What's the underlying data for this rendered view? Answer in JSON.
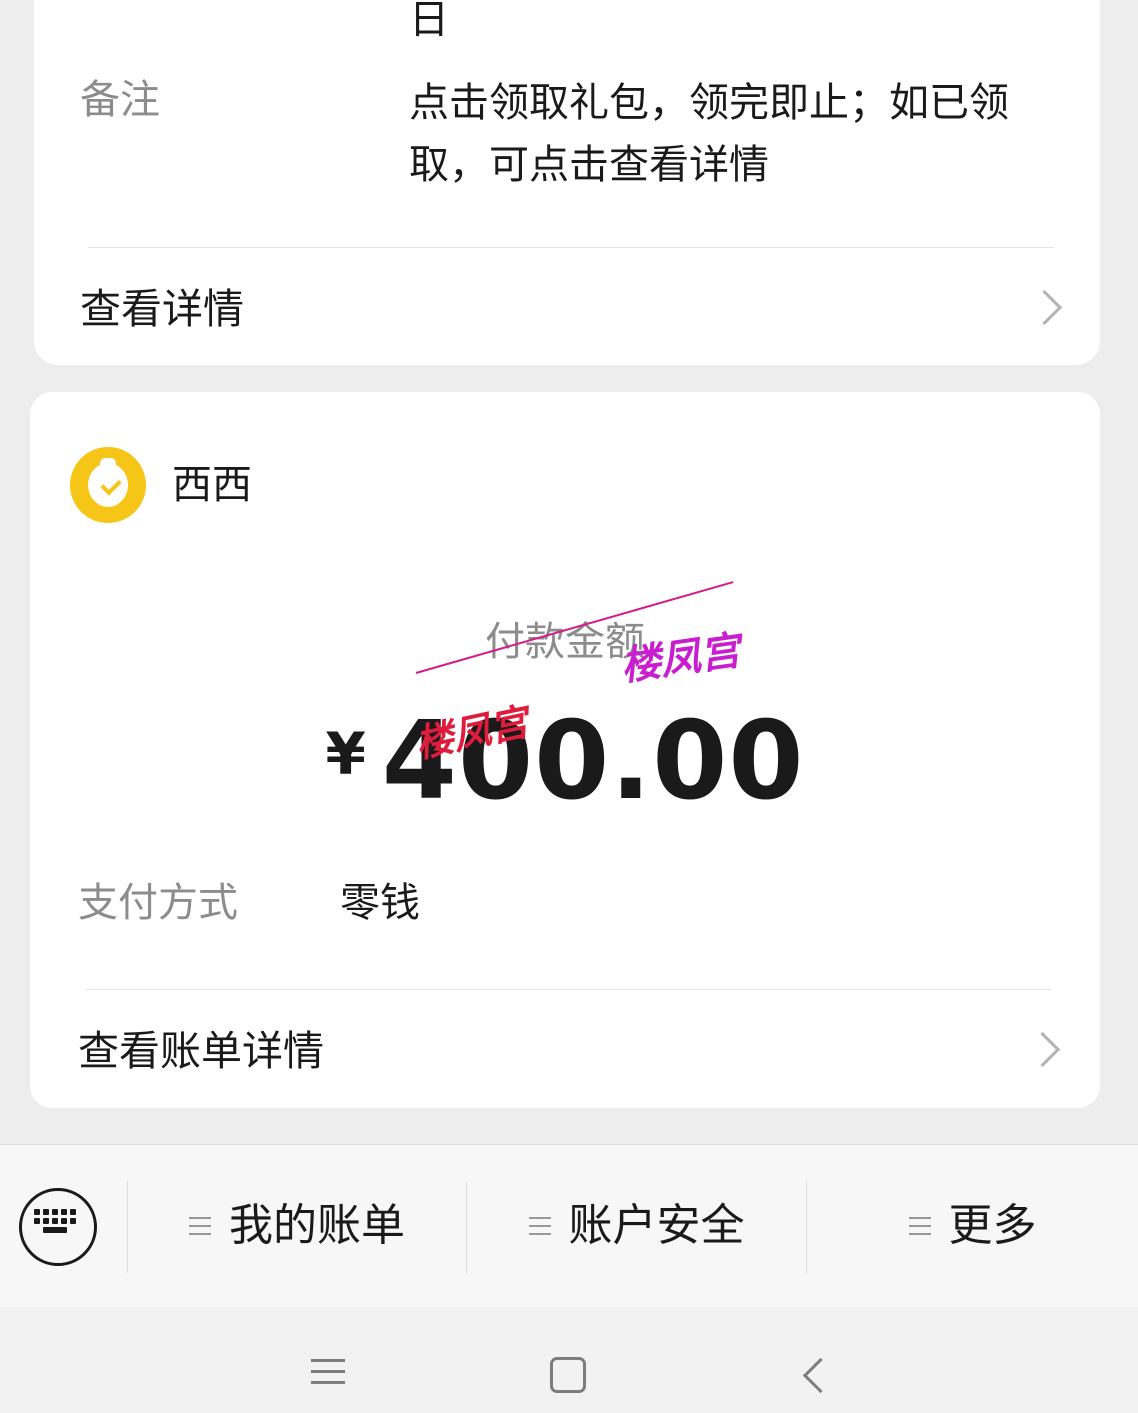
{
  "top_card": {
    "date_tail": "日",
    "remark_label": "备注",
    "remark_value": "点击领取礼包，领完即止；如已领取，可点击查看详情",
    "view_detail_label": "查看详情"
  },
  "payment_card": {
    "merchant_name": "西西",
    "amount_label": "付款金额",
    "currency_symbol": "¥",
    "amount": "400.00",
    "watermark_1": "楼凤宫",
    "watermark_2": "楼凤宫",
    "pay_method_label": "支付方式",
    "pay_method_value": "零钱",
    "bill_detail_label": "查看账单详情"
  },
  "menu_bar": {
    "items": [
      {
        "label": "我的账单"
      },
      {
        "label": "账户安全"
      },
      {
        "label": "更多"
      }
    ]
  },
  "colors": {
    "background": "#ededed",
    "card": "#ffffff",
    "secondary_text": "#8c8c8c",
    "merchant_logo": "#f5c518",
    "watermark": "#c81ecf"
  },
  "icons": {
    "merchant_logo": "money-bag-check-icon",
    "row_chevron": "chevron-right-icon",
    "keyboard": "keyboard-icon",
    "menu_item": "hamburger-icon",
    "nav_menu": "recent-apps-icon",
    "nav_home": "home-icon",
    "nav_back": "back-icon"
  }
}
